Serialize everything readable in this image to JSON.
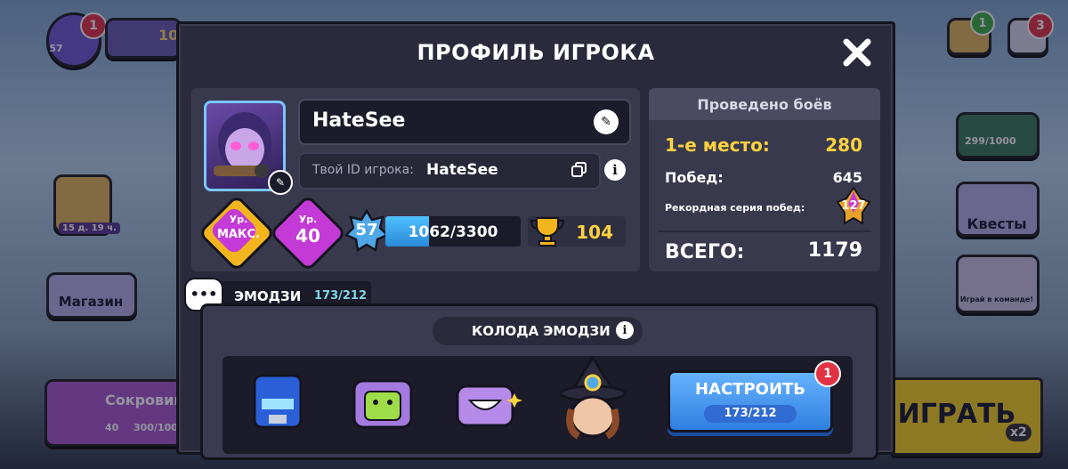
{
  "modal": {
    "title": "ПРОФИЛЬ ИГРОКА"
  },
  "profile": {
    "name": "HateSee",
    "id_label": "Твой ID игрока:",
    "id_value": "HateSee",
    "level_max_top": "Ур.",
    "level_max_bottom": "МАКС.",
    "level_top": "Ур.",
    "level_value": "40",
    "xp_level": "57",
    "xp_text": "1062/3300",
    "xp_fraction": 0.3218,
    "trophies": "104"
  },
  "battles": {
    "header": "Проведено боёв",
    "first_place_label": "1-е место:",
    "first_place_value": "280",
    "wins_label": "Побед:",
    "wins_value": "645",
    "streak_label": "Рекордная серия побед:",
    "streak_value": "127",
    "total_label": "ВСЕГО:",
    "total_value": "1179"
  },
  "emoji_tab": {
    "label": "ЭМОДЗИ",
    "count": "173/212"
  },
  "deck": {
    "title": "КОЛОДА ЭМОДЗИ",
    "setup_label": "НАСТРОИТЬ",
    "setup_count": "173/212",
    "setup_badge": "1",
    "emojis": [
      "robot-emoji",
      "android-emoji",
      "grin-emoji",
      "witch-emoji"
    ]
  },
  "background": {
    "profile_badge": "1",
    "profile_level": "57",
    "trophy_partial": "10",
    "event_timer": "15 д. 19 ч.",
    "shop_label": "Магазин",
    "treasure_label": "Сокровищ",
    "treasure_level": "40",
    "treasure_progress": "300/100",
    "pass_progress": "299/1000",
    "quests_label": "Квесты",
    "team_label": "Играй в команде!",
    "friends_badge": "1",
    "menu_badge": "3",
    "play_label": "ИГРАТЬ",
    "multiplier": "x2"
  },
  "colors": {
    "accent_yellow": "#ffd23f",
    "xp_blue": "#3aa8f2",
    "level_purple": "#c43ad6",
    "level_gold": "#f2b51e",
    "button_blue": "#4a9cf5"
  }
}
